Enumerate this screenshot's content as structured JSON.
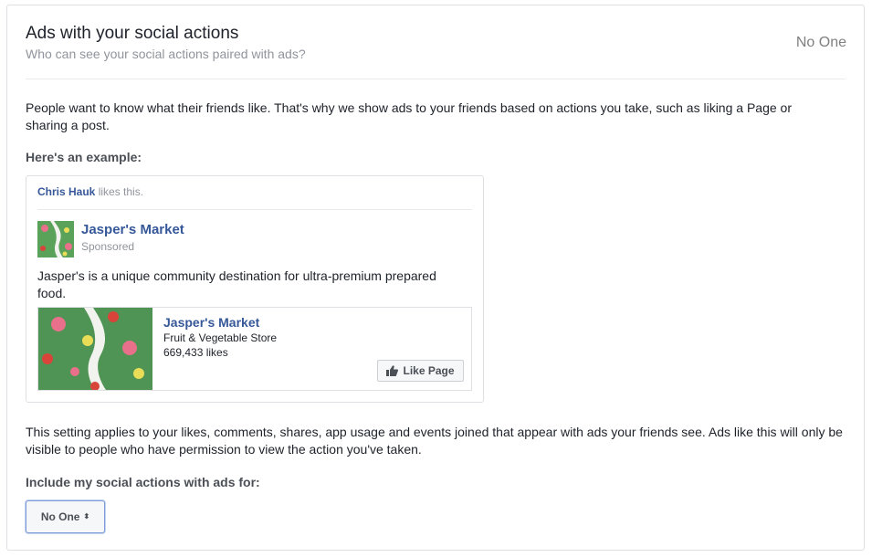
{
  "header": {
    "title": "Ads with your social actions",
    "subtitle": "Who can see your social actions paired with ads?",
    "current_value": "No One"
  },
  "intro": "People want to know what their friends like. That's why we show ads to your friends based on actions you take, such as liking a Page or sharing a post.",
  "example_heading": "Here's an example:",
  "example_ad": {
    "social_name": "Chris Hauk",
    "social_action": " likes this.",
    "page_name": "Jasper's Market",
    "sponsored_label": "Sponsored",
    "text": "Jasper's is a unique community destination for ultra-premium prepared food.",
    "card": {
      "name": "Jasper's Market",
      "category": "Fruit & Vegetable Store",
      "likes": "669,433 likes",
      "like_button": "Like Page"
    }
  },
  "note": "This setting applies to your likes, comments, shares, app usage and events joined that appear with ads your friends see. Ads like this will only be visible to people who have permission to view the action you've taken.",
  "include_heading": "Include my social actions with ads for:",
  "select": {
    "value": "No One",
    "caret": "⬍"
  },
  "icons": {
    "thumbs_up": "thumbs-up-icon",
    "select_caret": "sort-caret-icon"
  },
  "colors": {
    "link": "#365899",
    "muted": "#90949c",
    "border": "#dddfe2",
    "select_focus": "#7d9bd8"
  }
}
